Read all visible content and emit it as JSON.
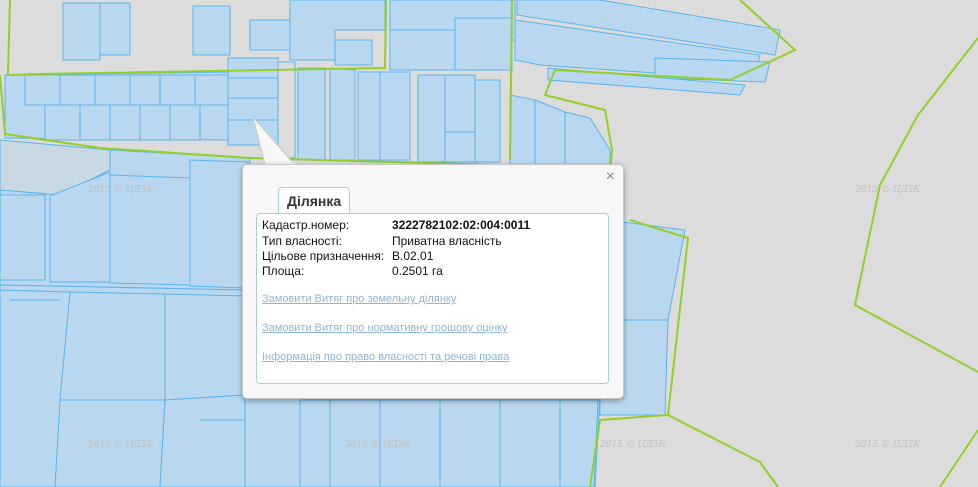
{
  "map": {
    "watermark": "2015 © ЦДЗК",
    "colors": {
      "background": "#dcdcdc",
      "parcel_fill": "#b9d8ef",
      "parcel_stroke": "#5ab4ee",
      "boundary": "#92cf2a",
      "dark_parcel": "#a5cbe8"
    }
  },
  "popup": {
    "close_glyph": "×",
    "tab_label": "Ділянка",
    "fields": [
      {
        "label": "Кадастр.номер:",
        "value": "3222782102:02:004:0011",
        "bold": true
      },
      {
        "label": "Тип власності:",
        "value": "Приватна власність",
        "bold": false
      },
      {
        "label": "Цільове призначення:",
        "value": "В.02.01",
        "bold": false
      },
      {
        "label": "Площа:",
        "value": "0.2501 га",
        "bold": false
      }
    ],
    "links": [
      "Замовити Витяг про земельну ділянку",
      "Замовити Витяг про нормативну грошову оцінку",
      "Інформація про право власності та речові права"
    ]
  }
}
